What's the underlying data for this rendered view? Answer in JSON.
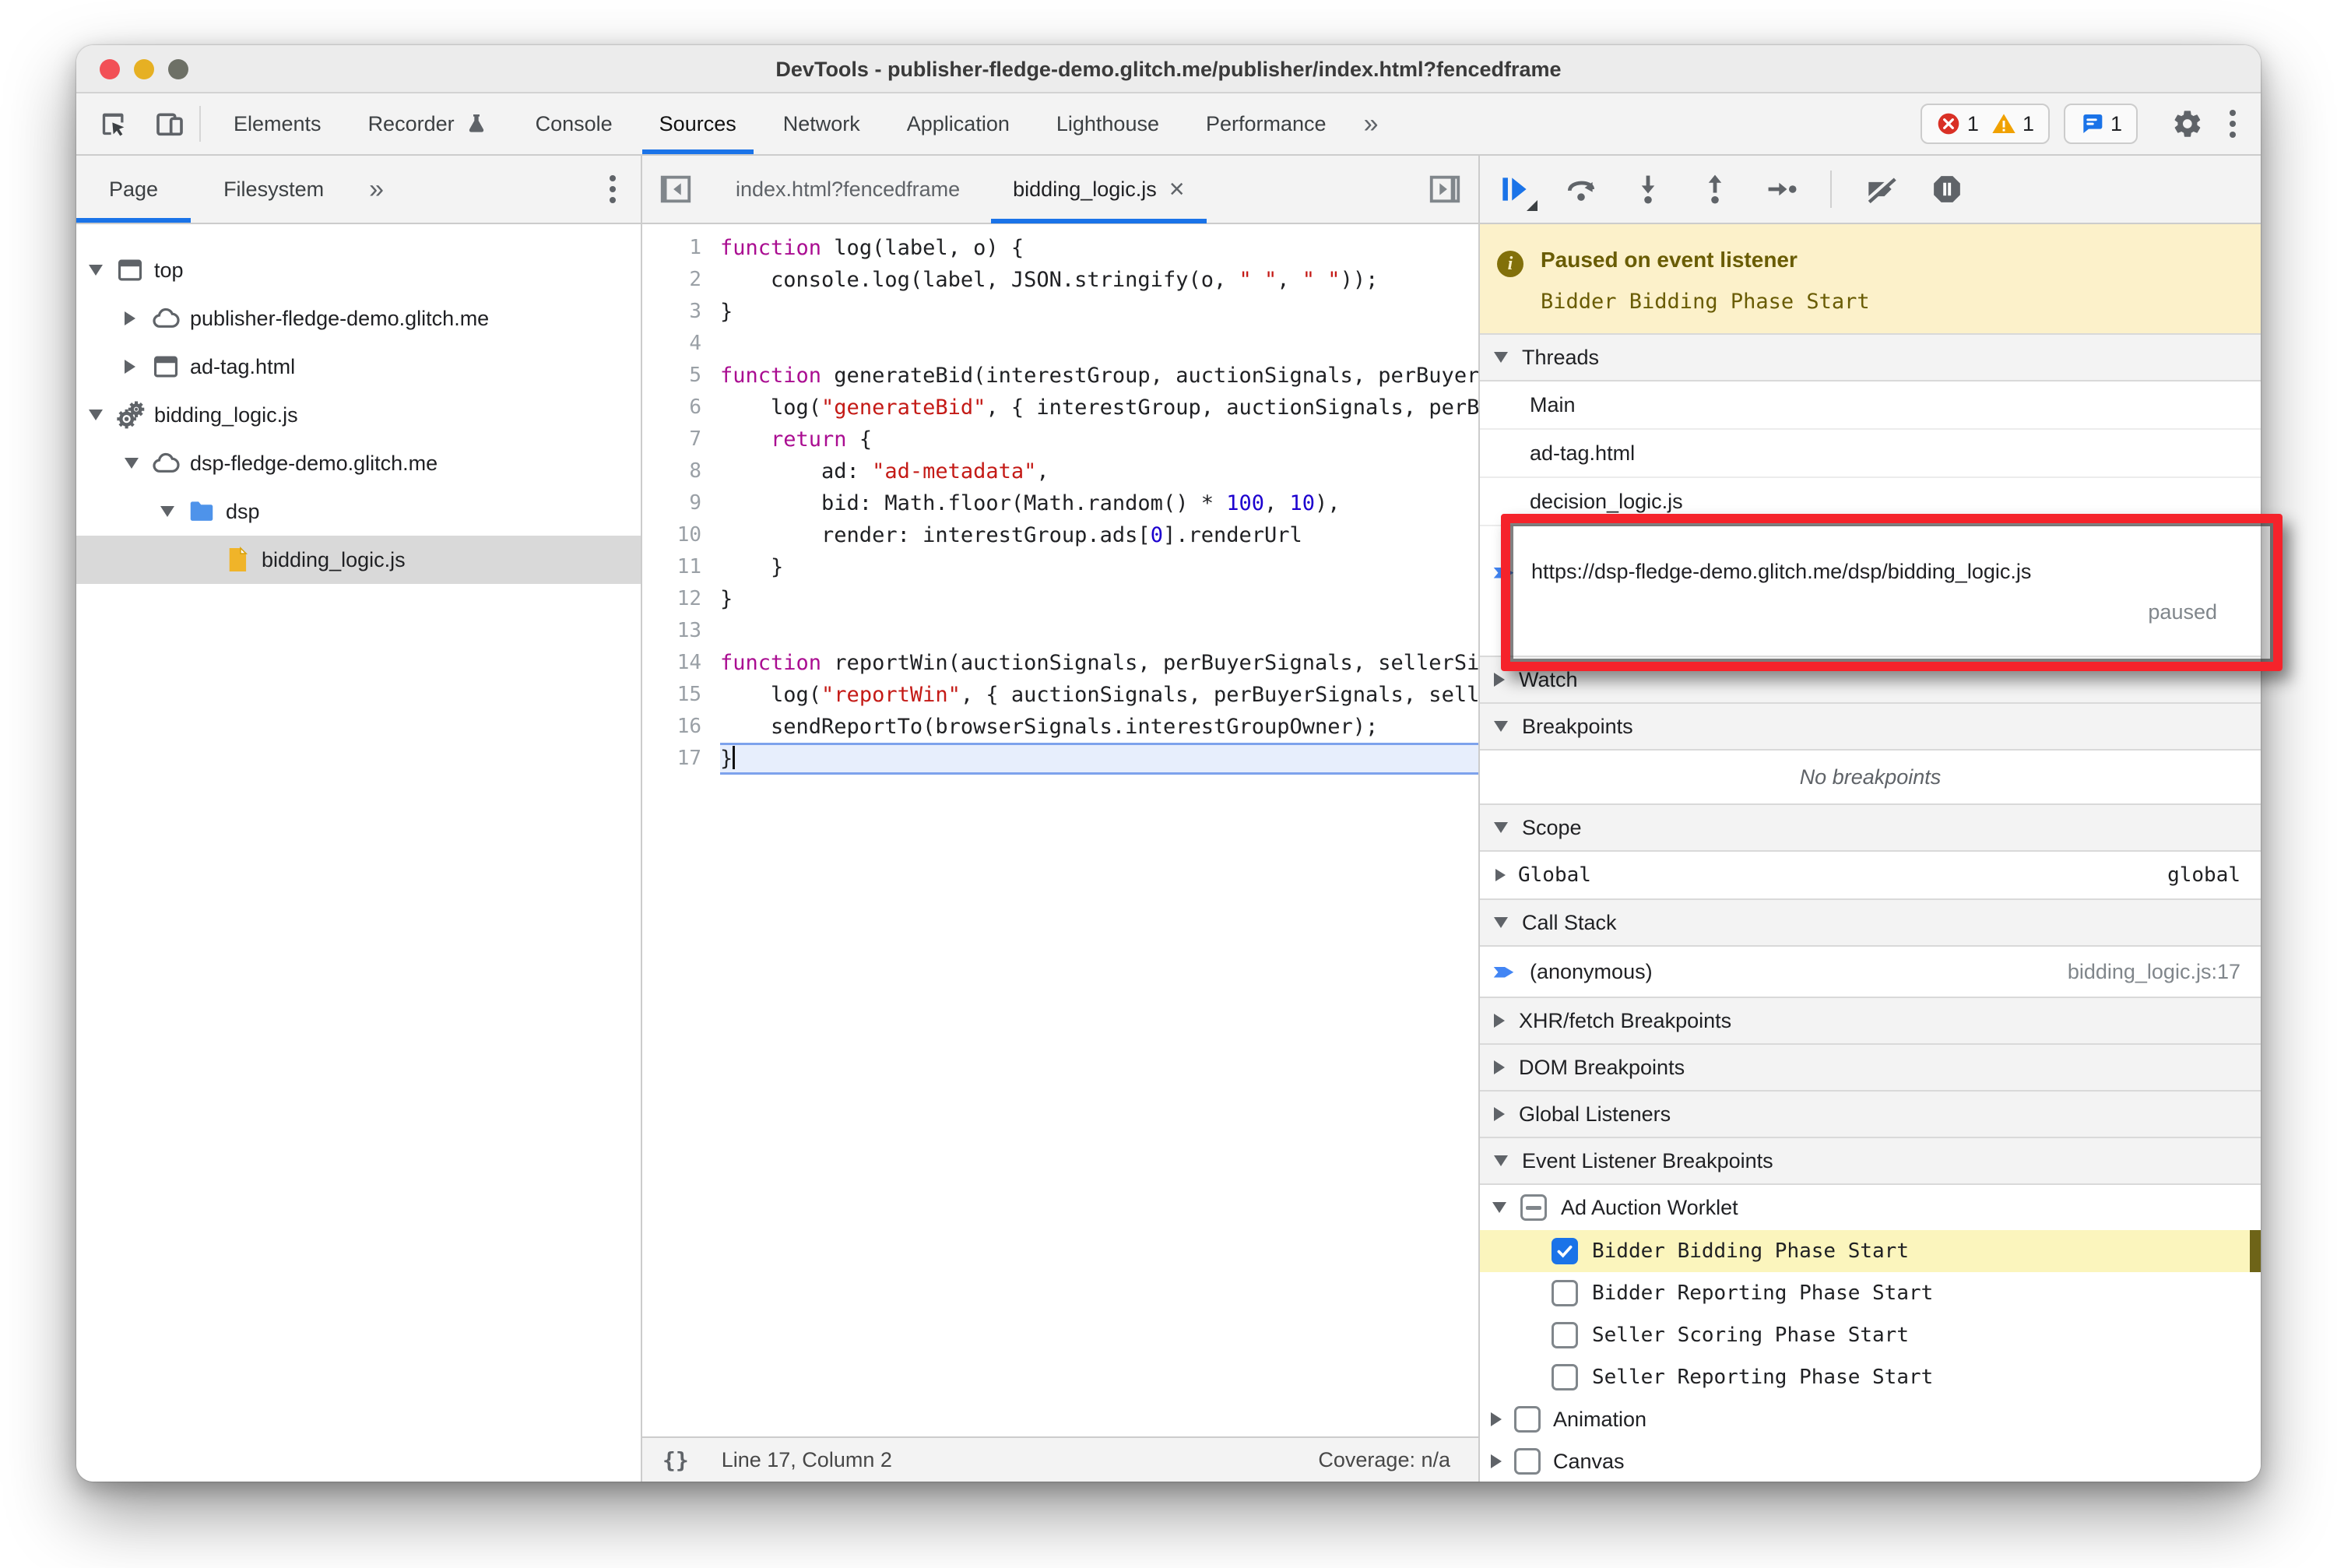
{
  "window": {
    "title": "DevTools - publisher-fledge-demo.glitch.me/publisher/index.html?fencedframe"
  },
  "chrome_toolbar": {
    "tabs": [
      {
        "label": "Elements",
        "active": false
      },
      {
        "label": "Recorder",
        "active": false,
        "icon": "flask-icon"
      },
      {
        "label": "Console",
        "active": false
      },
      {
        "label": "Sources",
        "active": true
      },
      {
        "label": "Network",
        "active": false
      },
      {
        "label": "Application",
        "active": false
      },
      {
        "label": "Lighthouse",
        "active": false
      },
      {
        "label": "Performance",
        "active": false
      }
    ],
    "overflow_chevron": "»",
    "error_count": "1",
    "warning_count": "1",
    "issue_count": "1"
  },
  "navigator": {
    "tabs": [
      {
        "label": "Page",
        "active": true
      },
      {
        "label": "Filesystem",
        "active": false
      }
    ],
    "overflow_chevron": "»",
    "tree": [
      {
        "level": 0,
        "expand": "down",
        "icon": "frame-icon",
        "label": "top"
      },
      {
        "level": 1,
        "expand": "right",
        "icon": "cloud-icon",
        "label": "publisher-fledge-demo.glitch.me"
      },
      {
        "level": 1,
        "expand": "right",
        "icon": "frame-icon",
        "label": "ad-tag.html"
      },
      {
        "level": 0,
        "expand": "down",
        "icon": "worklet-icon",
        "label": "bidding_logic.js"
      },
      {
        "level": 1,
        "expand": "down",
        "icon": "cloud-icon",
        "label": "dsp-fledge-demo.glitch.me"
      },
      {
        "level": 2,
        "expand": "down",
        "icon": "folder-icon",
        "label": "dsp"
      },
      {
        "level": 3,
        "expand": "none",
        "icon": "file-icon",
        "label": "bidding_logic.js",
        "selected": true
      }
    ]
  },
  "editor": {
    "tabs": [
      {
        "label": "index.html?fencedframe",
        "active": false
      },
      {
        "label": "bidding_logic.js",
        "active": true,
        "close": "×"
      }
    ],
    "lines": [
      {
        "n": "1",
        "tokens": [
          [
            "k",
            "function"
          ],
          [
            "p",
            " log(label, o) {"
          ]
        ]
      },
      {
        "n": "2",
        "tokens": [
          [
            "p",
            "    console.log(label, JSON.stringify(o, "
          ],
          [
            "s",
            "\" \""
          ],
          [
            "p",
            ", "
          ],
          [
            "s",
            "\" \""
          ],
          [
            "p",
            "));"
          ]
        ]
      },
      {
        "n": "3",
        "tokens": [
          [
            "p",
            "}"
          ]
        ]
      },
      {
        "n": "4",
        "tokens": []
      },
      {
        "n": "5",
        "tokens": [
          [
            "k",
            "function"
          ],
          [
            "p",
            " generateBid(interestGroup, auctionSignals, perBuyerSignals, trustedBiddingSignals, browserSignals) {"
          ]
        ]
      },
      {
        "n": "6",
        "tokens": [
          [
            "p",
            "    log("
          ],
          [
            "s",
            "\"generateBid\""
          ],
          [
            "p",
            ", { interestGroup, auctionSignals, perBuyerSignals, trustedBiddingSignals, browserSignals });"
          ]
        ]
      },
      {
        "n": "7",
        "tokens": [
          [
            "p",
            "    "
          ],
          [
            "k",
            "return"
          ],
          [
            "p",
            " {"
          ]
        ]
      },
      {
        "n": "8",
        "tokens": [
          [
            "p",
            "        ad: "
          ],
          [
            "s",
            "\"ad-metadata\""
          ],
          [
            "p",
            ","
          ]
        ]
      },
      {
        "n": "9",
        "tokens": [
          [
            "p",
            "        bid: Math.floor(Math.random() * "
          ],
          [
            "n",
            "100"
          ],
          [
            "p",
            ", "
          ],
          [
            "n",
            "10"
          ],
          [
            "p",
            "),"
          ]
        ]
      },
      {
        "n": "10",
        "tokens": [
          [
            "p",
            "        render: interestGroup.ads["
          ],
          [
            "n",
            "0"
          ],
          [
            "p",
            "].renderUrl"
          ]
        ]
      },
      {
        "n": "11",
        "tokens": [
          [
            "p",
            "    }"
          ]
        ]
      },
      {
        "n": "12",
        "tokens": [
          [
            "p",
            "}"
          ]
        ]
      },
      {
        "n": "13",
        "tokens": []
      },
      {
        "n": "14",
        "tokens": [
          [
            "k",
            "function"
          ],
          [
            "p",
            " reportWin(auctionSignals, perBuyerSignals, sellerSignals, browserSignals) {"
          ]
        ]
      },
      {
        "n": "15",
        "tokens": [
          [
            "p",
            "    log("
          ],
          [
            "s",
            "\"reportWin\""
          ],
          [
            "p",
            ", { auctionSignals, perBuyerSignals, sellerSignals, browserSignals });"
          ]
        ]
      },
      {
        "n": "16",
        "tokens": [
          [
            "p",
            "    sendReportTo(browserSignals.interestGroupOwner);"
          ]
        ]
      },
      {
        "n": "17",
        "tokens": [
          [
            "p",
            "}"
          ]
        ],
        "active": true
      }
    ],
    "status": {
      "pretty_print": "{}",
      "position": "Line 17, Column 2",
      "coverage": "Coverage: n/a"
    }
  },
  "debugger": {
    "paused_banner": {
      "title": "Paused on event listener",
      "detail": "Bidder Bidding Phase Start"
    },
    "threads": {
      "header": "Threads",
      "items": [
        {
          "label": "Main"
        },
        {
          "label": "ad-tag.html"
        },
        {
          "label": "decision_logic.js"
        }
      ],
      "paused_thread": {
        "url": "https://dsp-fledge-demo.glitch.me/dsp/bidding_logic.js",
        "status": "paused"
      }
    },
    "watch_header": "Watch",
    "breakpoints": {
      "header": "Breakpoints",
      "empty": "No breakpoints"
    },
    "scope": {
      "header": "Scope",
      "rows": [
        {
          "name": "Global",
          "value": "global"
        }
      ]
    },
    "call_stack": {
      "header": "Call Stack",
      "rows": [
        {
          "fn": "(anonymous)",
          "location": "bidding_logic.js:17"
        }
      ]
    },
    "xhr_header": "XHR/fetch Breakpoints",
    "dom_header": "DOM Breakpoints",
    "global_listeners_header": "Global Listeners",
    "event_listener_breakpoints": {
      "header": "Event Listener Breakpoints",
      "group": {
        "label": "Ad Auction Worklet",
        "state": "indeterminate",
        "items": [
          {
            "label": "Bidder Bidding Phase Start",
            "checked": true,
            "highlighted": true
          },
          {
            "label": "Bidder Reporting Phase Start",
            "checked": false,
            "highlighted": false
          },
          {
            "label": "Seller Scoring Phase Start",
            "checked": false,
            "highlighted": false
          },
          {
            "label": "Seller Reporting Phase Start",
            "checked": false,
            "highlighted": false
          }
        ]
      },
      "more_groups": [
        {
          "label": "Animation",
          "checked": false
        },
        {
          "label": "Canvas",
          "checked": false
        }
      ]
    }
  },
  "colors": {
    "accent": "#1a73e8",
    "error": "#d93025",
    "warning": "#f0a100",
    "issue": "#1a73e8",
    "paused_bg": "#fcf1ca",
    "paused_text": "#695c04",
    "highlight_row": "#fbf5bd",
    "annotation": "#f5232b",
    "keyword": "#aa0d91",
    "string": "#c41a16",
    "number": "#1c00cf"
  }
}
